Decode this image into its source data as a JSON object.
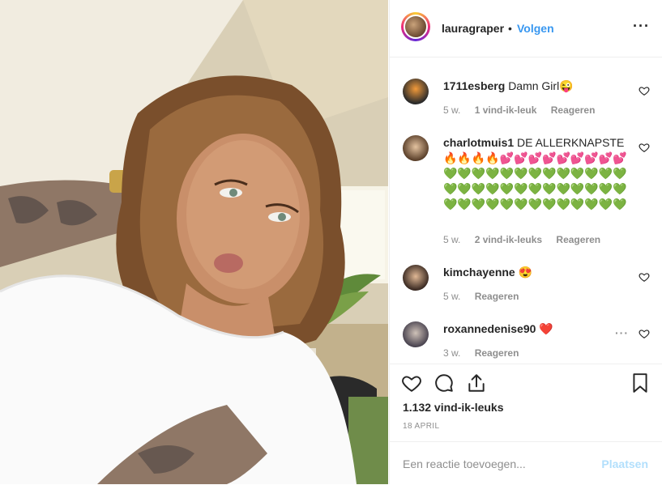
{
  "post": {
    "username": "lauragraper",
    "separator": "•",
    "follow_label": "Volgen",
    "more_label": "···"
  },
  "comments": [
    {
      "username": "1711esberg",
      "text": "Damn Girl😜",
      "age": "5 w.",
      "likes": "1 vind-ik-leuk",
      "reply": "Reageren"
    },
    {
      "username": "charlotmuis1",
      "text": "DE ALLERKNAPSTE 🔥🔥🔥🔥💕💕💕💕💕💕💕💕💕💚💚💚💚💚💚💚💚💚💚💚💚💚💚💚💚💚💚💚💚💚💚💚💚💚💚💚💚💚💚💚💚💚💚💚💚💚💚💚",
      "age": "5 w.",
      "likes": "2 vind-ik-leuks",
      "reply": "Reageren"
    },
    {
      "username": "kimchayenne",
      "text": "😍",
      "age": "5 w.",
      "reply": "Reageren"
    },
    {
      "username": "roxannedenise90",
      "text": "❤️",
      "age": "3 w.",
      "reply": "Reageren",
      "more_label": "···"
    }
  ],
  "footer": {
    "likes_count": "1.132 vind-ik-leuks",
    "date": "18 APRIL",
    "comment_placeholder": "Een reactie toevoegen...",
    "post_label": "Plaatsen"
  },
  "icons": {
    "like": "heart-icon",
    "comment": "speech-bubble-icon",
    "share": "share-icon",
    "save": "bookmark-icon"
  },
  "colors": {
    "link_blue": "#3897f0",
    "disabled_blue": "#b2dffc",
    "meta_gray": "#8e8e8e"
  }
}
